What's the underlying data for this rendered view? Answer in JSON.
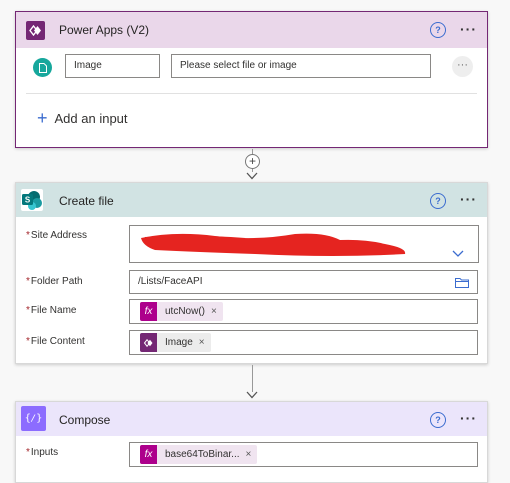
{
  "powerapps": {
    "title": "Power Apps (V2)",
    "accent": "#742774",
    "input_name": "Image",
    "input_placeholder": "Please select file or image",
    "add_input_label": "Add an input"
  },
  "create_file": {
    "title": "Create file",
    "accent": "#036c70",
    "fields": {
      "site_address_label": "Site Address",
      "folder_path_label": "Folder Path",
      "folder_path_value": "/Lists/FaceAPI",
      "file_name_label": "File Name",
      "file_name_token": "utcNow()",
      "file_content_label": "File Content",
      "file_content_token": "Image"
    }
  },
  "compose": {
    "title": "Compose",
    "accent": "#8c6cff",
    "inputs_label": "Inputs",
    "inputs_token": "base64ToBinar..."
  },
  "common": {
    "help_glyph": "?",
    "more_glyph": "···",
    "remove_glyph": "×",
    "required_mark": "*",
    "add_glyph": "+"
  }
}
